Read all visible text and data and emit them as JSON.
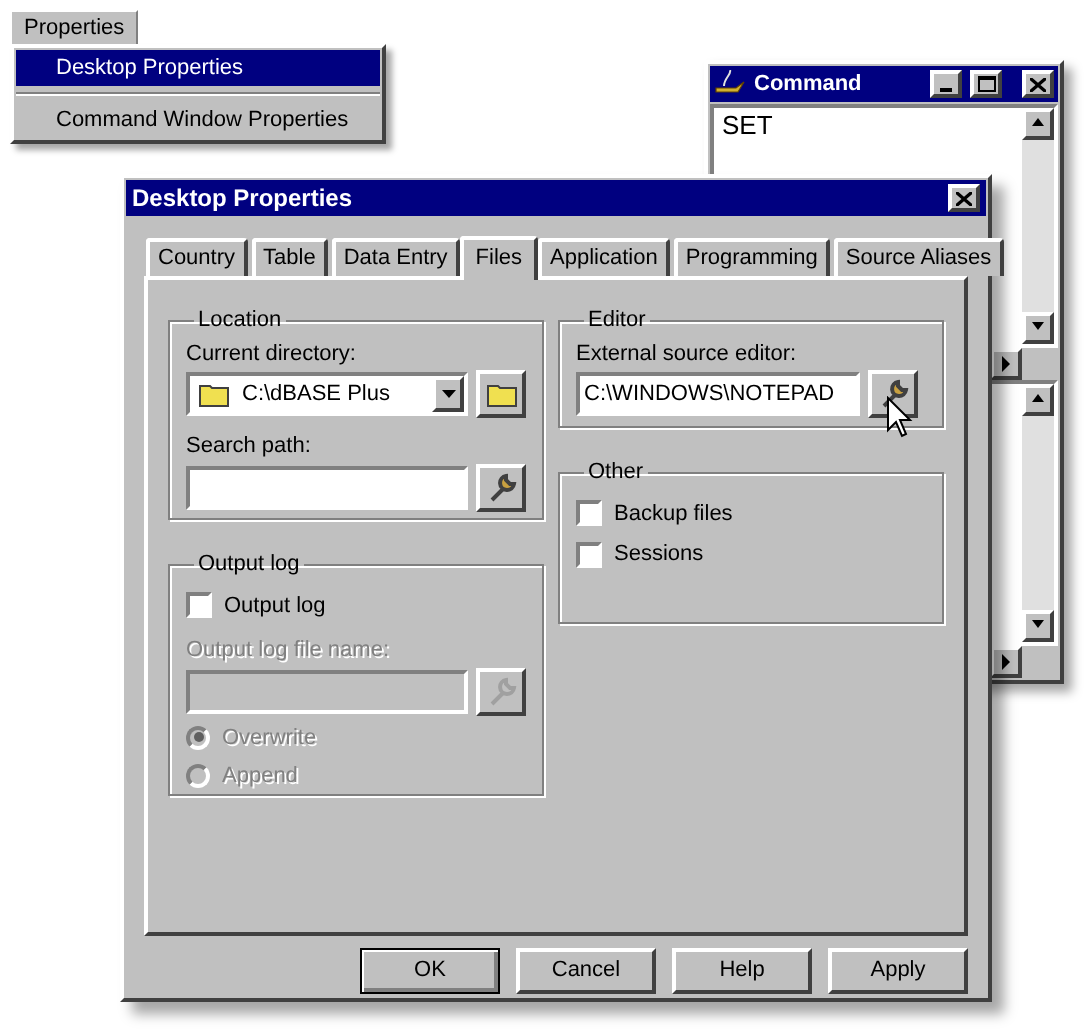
{
  "menu_bar": {
    "label": "Properties"
  },
  "menu": [
    {
      "label": "Desktop Properties",
      "selected": true
    },
    {
      "label": "Command Window Properties",
      "selected": false
    }
  ],
  "command_window": {
    "title": "Command",
    "text": "SET"
  },
  "dialog": {
    "title": "Desktop Properties",
    "tabs": [
      {
        "label": "Country",
        "selected": false
      },
      {
        "label": "Table",
        "selected": false
      },
      {
        "label": "Data Entry",
        "selected": false
      },
      {
        "label": "Files",
        "selected": true
      },
      {
        "label": "Application",
        "selected": false
      },
      {
        "label": "Programming",
        "selected": false
      },
      {
        "label": "Source Aliases",
        "selected": false
      }
    ],
    "location": {
      "title": "Location",
      "current_directory": {
        "label": "Current directory:",
        "value": "C:\\dBASE Plus"
      },
      "search_path": {
        "label": "Search path:"
      }
    },
    "output_log": {
      "title": "Output log",
      "checkbox": {
        "label": "Output log",
        "checked": false
      },
      "file_name": {
        "label": "Output log file name:",
        "disabled": true
      },
      "options": [
        {
          "label": "Overwrite",
          "selected": true,
          "disabled": true
        },
        {
          "label": "Append",
          "selected": false,
          "disabled": true
        }
      ]
    },
    "editor": {
      "title": "Editor",
      "label": "External source editor:",
      "value": "C:\\WINDOWS\\NOTEPAD"
    },
    "other": {
      "title": "Other",
      "options": [
        {
          "label": "Backup files",
          "checked": false
        },
        {
          "label": "Sessions",
          "checked": false
        }
      ]
    },
    "buttons": [
      {
        "label": "OK",
        "default": true
      },
      {
        "label": "Cancel",
        "default": false
      },
      {
        "label": "Help",
        "default": false
      },
      {
        "label": "Apply",
        "default": false
      }
    ]
  }
}
